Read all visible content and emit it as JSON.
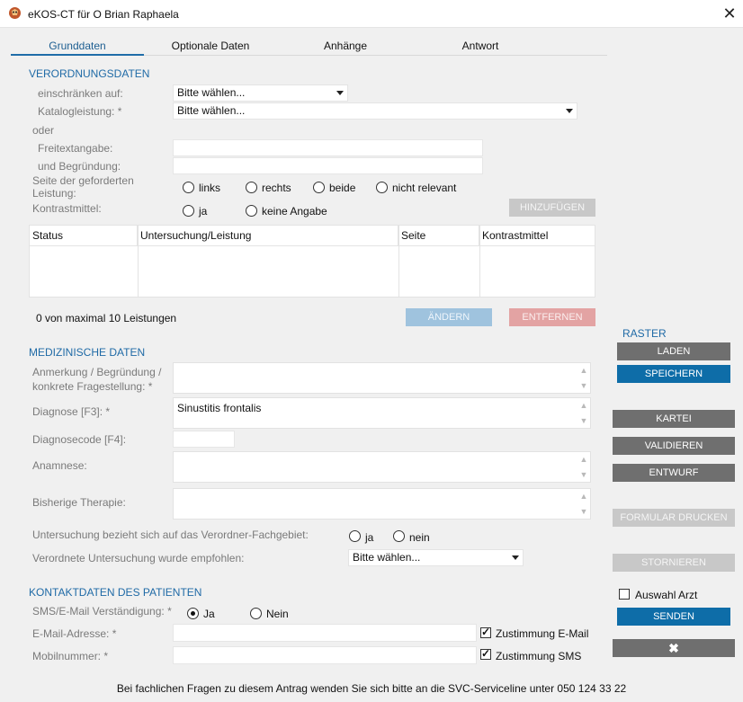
{
  "window": {
    "title": "eKOS-CT für O Brian Raphaela"
  },
  "tabs": [
    {
      "label": "Grunddaten"
    },
    {
      "label": "Optionale Daten"
    },
    {
      "label": "Anhänge"
    },
    {
      "label": "Antwort"
    }
  ],
  "verordnung": {
    "section_title": "VERORDNUNGSDATEN",
    "einschraenken_label": "einschränken auf:",
    "einschraenken_value": "Bitte wählen...",
    "katalog_label": "Katalogleistung: *",
    "katalog_value": "Bitte wählen...",
    "oder_label": "oder",
    "freitext_label": "Freitextangabe:",
    "begruendung_label": "und Begründung:",
    "seite_label": "Seite der geforderten Leistung:",
    "seite_options": [
      "links",
      "rechts",
      "beide",
      "nicht relevant"
    ],
    "kontrast_label": "Kontrastmittel:",
    "kontrast_options": [
      "ja",
      "keine Angabe"
    ],
    "add_button": "HINZUFÜGEN",
    "table_headers": [
      "Status",
      "Untersuchung/Leistung",
      "Seite",
      "Kontrastmittel"
    ],
    "count_text": "0  von maximal 10 Leistungen",
    "change_button": "ÄNDERN",
    "remove_button": "ENTFERNEN"
  },
  "medizin": {
    "section_title": "MEDIZINISCHE DATEN",
    "anmerkung_label_1": "Anmerkung / Begründung /",
    "anmerkung_label_2": "konkrete Fragestellung: *",
    "diagnose_label": "Diagnose [F3]: *",
    "diagnose_value": "Sinustitis frontalis",
    "diagnosecode_label": "Diagnosecode [F4]:",
    "anamnese_label": "Anamnese:",
    "therapie_label": "Bisherige Therapie:",
    "fachgebiet_label": "Untersuchung bezieht sich auf das Verordner-Fachgebiet:",
    "fachgebiet_options": [
      "ja",
      "nein"
    ],
    "empfohlen_label": "Verordnete Untersuchung wurde empfohlen:",
    "empfohlen_value": "Bitte wählen..."
  },
  "kontakt": {
    "section_title": "KONTAKTDATEN DES PATIENTEN",
    "sms_label": "SMS/E-Mail Verständigung: *",
    "sms_options": [
      "Ja",
      "Nein"
    ],
    "sms_selected": "Ja",
    "email_label": "E-Mail-Adresse: *",
    "email_consent": "Zustimmung E-Mail",
    "email_consent_checked": true,
    "mobil_label": "Mobilnummer: *",
    "sms_consent": "Zustimmung SMS",
    "sms_consent_checked": true
  },
  "sidebar": {
    "raster_title": "RASTER",
    "laden": "LADEN",
    "speichern": "SPEICHERN",
    "kartei": "KARTEI",
    "validieren": "VALIDIEREN",
    "entwurf": "ENTWURF",
    "formular_drucken": "FORMULAR DRUCKEN",
    "stornieren": "STORNIEREN",
    "auswahl_arzt": "Auswahl Arzt",
    "senden": "SENDEN",
    "cancel_icon": "close-icon"
  },
  "footer": {
    "text": "Bei fachlichen Fragen zu diesem Antrag wenden Sie sich bitte an die SVC-Serviceline unter 050 124 33 22"
  },
  "colors": {
    "accent": "#1f6aa6",
    "primary_button": "#0e6da8",
    "gray_button": "#6f6f6f"
  }
}
